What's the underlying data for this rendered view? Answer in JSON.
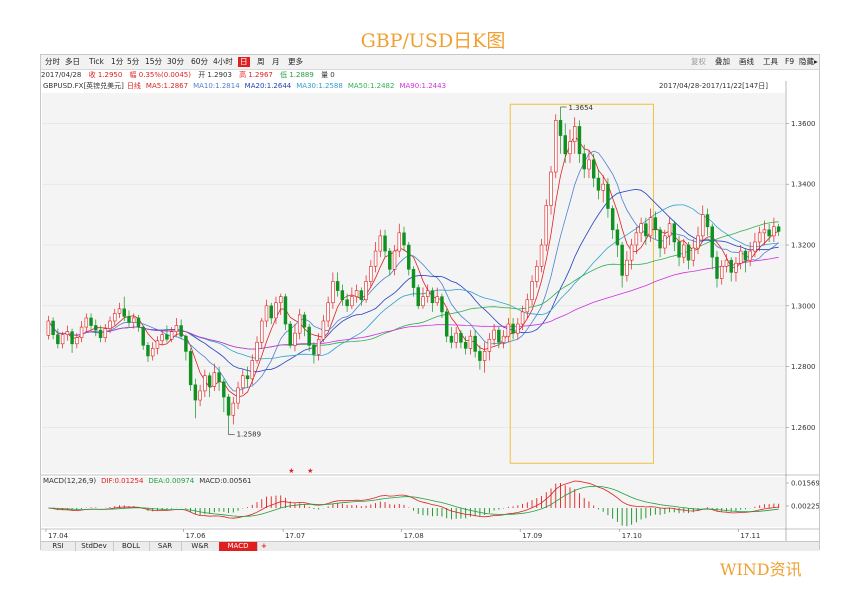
{
  "page_title": "GBP/USD日K图",
  "footer_text": "WIND资讯",
  "toolbar": {
    "tabs": [
      "分时",
      "多日",
      "Tick",
      "1分",
      "5分",
      "15分",
      "30分",
      "60分",
      "4小时",
      "日",
      "周",
      "月",
      "更多"
    ],
    "active_index": 9,
    "right_items": [
      {
        "label": "复权",
        "dim": true
      },
      {
        "label": "叠加",
        "dim": false
      },
      {
        "label": "画线",
        "dim": false
      },
      {
        "label": "工具",
        "dim": false
      },
      {
        "label": "F9",
        "dim": false
      },
      {
        "label": "隐藏▸",
        "dim": false
      }
    ]
  },
  "info_bar": {
    "date": "2017/04/28",
    "close": "收 1.2950",
    "change": "幅 0.35%(0.0045)",
    "open": "开 1.2903",
    "high": "高 1.2967",
    "low": "低 1.2889",
    "volume": "量 0"
  },
  "legend": {
    "symbol": "GBPUSD.FX",
    "name": "[英镑兑美元]",
    "period": "日线",
    "ma": [
      {
        "label": "MA5:1.2867",
        "color": "#e02020"
      },
      {
        "label": "MA10:1.2814",
        "color": "#5080d0"
      },
      {
        "label": "MA20:1.2644",
        "color": "#2040c0"
      },
      {
        "label": "MA30:1.2588",
        "color": "#30a0d0"
      },
      {
        "label": "MA50:1.2482",
        "color": "#30b050"
      },
      {
        "label": "MA90:1.2443",
        "color": "#d030e0"
      }
    ],
    "range": "2017/04/28-2017/11/22[147日]"
  },
  "annotations": {
    "high_label": "1.3654",
    "low_label": "1.2589"
  },
  "macd_legend": {
    "params": "MACD(12,26,9)",
    "dif": "DIF:0.01254",
    "dea": "DEA:0.00974",
    "macd": "MACD:0.00561"
  },
  "bottom_tabs": [
    "RSI",
    "StdDev",
    "BOLL",
    "SAR",
    "W&R",
    "MACD"
  ],
  "bottom_active": 5,
  "colors": {
    "up": "#e02020",
    "down": "#109020",
    "highlight": "#f0c040"
  },
  "chart_data": {
    "type": "candlestick",
    "title": "GBP/USD日K图",
    "y_ticks": [
      1.26,
      1.28,
      1.3,
      1.32,
      1.34,
      1.36
    ],
    "y_range": [
      1.245,
      1.37
    ],
    "x_tick_labels": [
      "17.04",
      "17.06",
      "17.07",
      "17.08",
      "17.09",
      "17.10",
      "17.11"
    ],
    "x_tick_index": [
      0,
      29,
      50,
      75,
      100,
      121,
      146
    ],
    "candles": [
      [
        1.2903,
        1.295,
        1.2967,
        1.2889
      ],
      [
        1.295,
        1.2905,
        1.2962,
        1.289
      ],
      [
        1.2905,
        1.2875,
        1.2925,
        1.286
      ],
      [
        1.2875,
        1.2905,
        1.2915,
        1.286
      ],
      [
        1.2905,
        1.2915,
        1.2935,
        1.2885
      ],
      [
        1.2915,
        1.2875,
        1.2925,
        1.2845
      ],
      [
        1.2875,
        1.2895,
        1.291,
        1.286
      ],
      [
        1.2895,
        1.293,
        1.295,
        1.288
      ],
      [
        1.293,
        1.296,
        1.2975,
        1.2915
      ],
      [
        1.296,
        1.2935,
        1.2975,
        1.292
      ],
      [
        1.2935,
        1.292,
        1.2955,
        1.29
      ],
      [
        1.292,
        1.2895,
        1.2935,
        1.288
      ],
      [
        1.2895,
        1.2925,
        1.294,
        1.288
      ],
      [
        1.2925,
        1.295,
        1.2965,
        1.291
      ],
      [
        1.295,
        1.2975,
        1.299,
        1.2935
      ],
      [
        1.2975,
        1.299,
        1.301,
        1.296
      ],
      [
        1.299,
        1.2965,
        1.303,
        1.295
      ],
      [
        1.2965,
        1.2945,
        1.2985,
        1.293
      ],
      [
        1.2945,
        1.296,
        1.2975,
        1.2925
      ],
      [
        1.296,
        1.293,
        1.297,
        1.2915
      ],
      [
        1.293,
        1.287,
        1.2935,
        1.2855
      ],
      [
        1.287,
        1.2835,
        1.288,
        1.2815
      ],
      [
        1.2835,
        1.286,
        1.288,
        1.282
      ],
      [
        1.286,
        1.2885,
        1.29,
        1.284
      ],
      [
        1.2885,
        1.2905,
        1.292,
        1.287
      ],
      [
        1.2905,
        1.289,
        1.2935,
        1.288
      ],
      [
        1.289,
        1.2915,
        1.293,
        1.288
      ],
      [
        1.2915,
        1.2935,
        1.296,
        1.29
      ],
      [
        1.2935,
        1.29,
        1.2955,
        1.289
      ],
      [
        1.29,
        1.285,
        1.2905,
        1.282
      ],
      [
        1.285,
        1.274,
        1.286,
        1.272
      ],
      [
        1.274,
        1.269,
        1.276,
        1.263
      ],
      [
        1.269,
        1.272,
        1.274,
        1.267
      ],
      [
        1.272,
        1.277,
        1.279,
        1.27
      ],
      [
        1.277,
        1.2735,
        1.278,
        1.27
      ],
      [
        1.2735,
        1.278,
        1.281,
        1.272
      ],
      [
        1.278,
        1.275,
        1.28,
        1.272
      ],
      [
        1.275,
        1.27,
        1.276,
        1.265
      ],
      [
        1.27,
        1.264,
        1.271,
        1.259
      ],
      [
        1.264,
        1.268,
        1.27,
        1.261
      ],
      [
        1.268,
        1.273,
        1.275,
        1.266
      ],
      [
        1.273,
        1.277,
        1.279,
        1.271
      ],
      [
        1.277,
        1.276,
        1.28,
        1.273
      ],
      [
        1.276,
        1.282,
        1.284,
        1.274
      ],
      [
        1.282,
        1.288,
        1.29,
        1.281
      ],
      [
        1.288,
        1.295,
        1.296,
        1.286
      ],
      [
        1.295,
        1.3,
        1.302,
        1.293
      ],
      [
        1.3,
        1.296,
        1.301,
        1.294
      ],
      [
        1.296,
        1.301,
        1.303,
        1.294
      ],
      [
        1.301,
        1.303,
        1.304,
        1.297
      ],
      [
        1.303,
        1.294,
        1.304,
        1.292
      ],
      [
        1.294,
        1.287,
        1.295,
        1.286
      ],
      [
        1.287,
        1.291,
        1.294,
        1.285
      ],
      [
        1.291,
        1.297,
        1.299,
        1.289
      ],
      [
        1.297,
        1.293,
        1.298,
        1.29
      ],
      [
        1.293,
        1.287,
        1.294,
        1.285
      ],
      [
        1.287,
        1.284,
        1.288,
        1.281
      ],
      [
        1.284,
        1.289,
        1.291,
        1.282
      ],
      [
        1.289,
        1.295,
        1.297,
        1.288
      ],
      [
        1.295,
        1.301,
        1.303,
        1.293
      ],
      [
        1.301,
        1.308,
        1.311,
        1.299
      ],
      [
        1.308,
        1.305,
        1.311,
        1.303
      ],
      [
        1.305,
        1.302,
        1.307,
        1.3
      ],
      [
        1.302,
        1.3,
        1.304,
        1.298
      ],
      [
        1.3,
        1.303,
        1.306,
        1.299
      ],
      [
        1.303,
        1.305,
        1.307,
        1.301
      ],
      [
        1.305,
        1.302,
        1.306,
        1.3
      ],
      [
        1.302,
        1.308,
        1.31,
        1.301
      ],
      [
        1.308,
        1.313,
        1.315,
        1.306
      ],
      [
        1.313,
        1.318,
        1.321,
        1.311
      ],
      [
        1.318,
        1.323,
        1.325,
        1.316
      ],
      [
        1.323,
        1.318,
        1.325,
        1.316
      ],
      [
        1.318,
        1.312,
        1.319,
        1.31
      ],
      [
        1.312,
        1.318,
        1.32,
        1.31
      ],
      [
        1.318,
        1.324,
        1.327,
        1.316
      ],
      [
        1.324,
        1.32,
        1.326,
        1.318
      ],
      [
        1.32,
        1.312,
        1.321,
        1.31
      ],
      [
        1.312,
        1.306,
        1.313,
        1.303
      ],
      [
        1.306,
        1.3,
        1.307,
        1.299
      ],
      [
        1.3,
        1.303,
        1.306,
        1.299
      ],
      [
        1.303,
        1.305,
        1.307,
        1.301
      ],
      [
        1.305,
        1.301,
        1.306,
        1.298
      ],
      [
        1.301,
        1.303,
        1.306,
        1.3
      ],
      [
        1.303,
        1.298,
        1.304,
        1.296
      ],
      [
        1.298,
        1.29,
        1.299,
        1.288
      ],
      [
        1.29,
        1.288,
        1.293,
        1.286
      ],
      [
        1.288,
        1.291,
        1.293,
        1.286
      ],
      [
        1.291,
        1.288,
        1.292,
        1.286
      ],
      [
        1.288,
        1.286,
        1.29,
        1.284
      ],
      [
        1.286,
        1.29,
        1.292,
        1.284
      ],
      [
        1.29,
        1.285,
        1.292,
        1.283
      ],
      [
        1.285,
        1.282,
        1.287,
        1.279
      ],
      [
        1.282,
        1.285,
        1.288,
        1.278
      ],
      [
        1.285,
        1.289,
        1.291,
        1.282
      ],
      [
        1.289,
        1.292,
        1.294,
        1.287
      ],
      [
        1.292,
        1.288,
        1.293,
        1.286
      ],
      [
        1.288,
        1.29,
        1.292,
        1.286
      ],
      [
        1.29,
        1.294,
        1.296,
        1.288
      ],
      [
        1.294,
        1.291,
        1.296,
        1.289
      ],
      [
        1.291,
        1.294,
        1.296,
        1.289
      ],
      [
        1.294,
        1.298,
        1.3,
        1.292
      ],
      [
        1.298,
        1.302,
        1.304,
        1.296
      ],
      [
        1.302,
        1.308,
        1.31,
        1.3
      ],
      [
        1.308,
        1.313,
        1.315,
        1.306
      ],
      [
        1.313,
        1.32,
        1.322,
        1.311
      ],
      [
        1.32,
        1.333,
        1.335,
        1.318
      ],
      [
        1.333,
        1.344,
        1.346,
        1.33
      ],
      [
        1.344,
        1.361,
        1.363,
        1.342
      ],
      [
        1.361,
        1.356,
        1.3654,
        1.35
      ],
      [
        1.356,
        1.35,
        1.36,
        1.347
      ],
      [
        1.35,
        1.354,
        1.358,
        1.347
      ],
      [
        1.354,
        1.359,
        1.362,
        1.35
      ],
      [
        1.359,
        1.35,
        1.361,
        1.347
      ],
      [
        1.35,
        1.345,
        1.353,
        1.342
      ],
      [
        1.345,
        1.348,
        1.351,
        1.342
      ],
      [
        1.348,
        1.342,
        1.35,
        1.339
      ],
      [
        1.342,
        1.338,
        1.345,
        1.335
      ],
      [
        1.338,
        1.34,
        1.343,
        1.334
      ],
      [
        1.34,
        1.332,
        1.342,
        1.329
      ],
      [
        1.332,
        1.325,
        1.333,
        1.322
      ],
      [
        1.325,
        1.32,
        1.327,
        1.316
      ],
      [
        1.32,
        1.31,
        1.321,
        1.306
      ],
      [
        1.31,
        1.315,
        1.318,
        1.308
      ],
      [
        1.315,
        1.32,
        1.322,
        1.312
      ],
      [
        1.32,
        1.324,
        1.326,
        1.317
      ],
      [
        1.324,
        1.327,
        1.329,
        1.321
      ],
      [
        1.327,
        1.323,
        1.329,
        1.32
      ],
      [
        1.323,
        1.329,
        1.332,
        1.321
      ],
      [
        1.329,
        1.325,
        1.331,
        1.322
      ],
      [
        1.325,
        1.319,
        1.326,
        1.316
      ],
      [
        1.319,
        1.323,
        1.325,
        1.317
      ],
      [
        1.323,
        1.327,
        1.329,
        1.32
      ],
      [
        1.327,
        1.321,
        1.328,
        1.318
      ],
      [
        1.321,
        1.316,
        1.323,
        1.313
      ],
      [
        1.316,
        1.32,
        1.322,
        1.314
      ],
      [
        1.32,
        1.315,
        1.321,
        1.312
      ],
      [
        1.315,
        1.319,
        1.322,
        1.313
      ],
      [
        1.319,
        1.323,
        1.326,
        1.317
      ],
      [
        1.323,
        1.33,
        1.333,
        1.321
      ],
      [
        1.33,
        1.326,
        1.332,
        1.323
      ],
      [
        1.326,
        1.316,
        1.327,
        1.312
      ],
      [
        1.316,
        1.309,
        1.318,
        1.306
      ],
      [
        1.309,
        1.313,
        1.315,
        1.307
      ],
      [
        1.313,
        1.315,
        1.317,
        1.311
      ],
      [
        1.315,
        1.311,
        1.316,
        1.308
      ],
      [
        1.311,
        1.314,
        1.316,
        1.308
      ],
      [
        1.314,
        1.318,
        1.32,
        1.312
      ],
      [
        1.318,
        1.315,
        1.319,
        1.311
      ],
      [
        1.315,
        1.318,
        1.321,
        1.313
      ],
      [
        1.318,
        1.321,
        1.324,
        1.316
      ],
      [
        1.321,
        1.324,
        1.326,
        1.318
      ],
      [
        1.324,
        1.325,
        1.328,
        1.32
      ],
      [
        1.325,
        1.323,
        1.327,
        1.321
      ],
      [
        1.323,
        1.326,
        1.329,
        1.321
      ],
      [
        1.326,
        1.3245,
        1.327,
        1.323
      ]
    ],
    "ma_periods": [
      5,
      10,
      20,
      30,
      50,
      90
    ],
    "macd_ticks": [
      0.01569,
      0.00225
    ],
    "macd_params": [
      12,
      26,
      9
    ]
  }
}
